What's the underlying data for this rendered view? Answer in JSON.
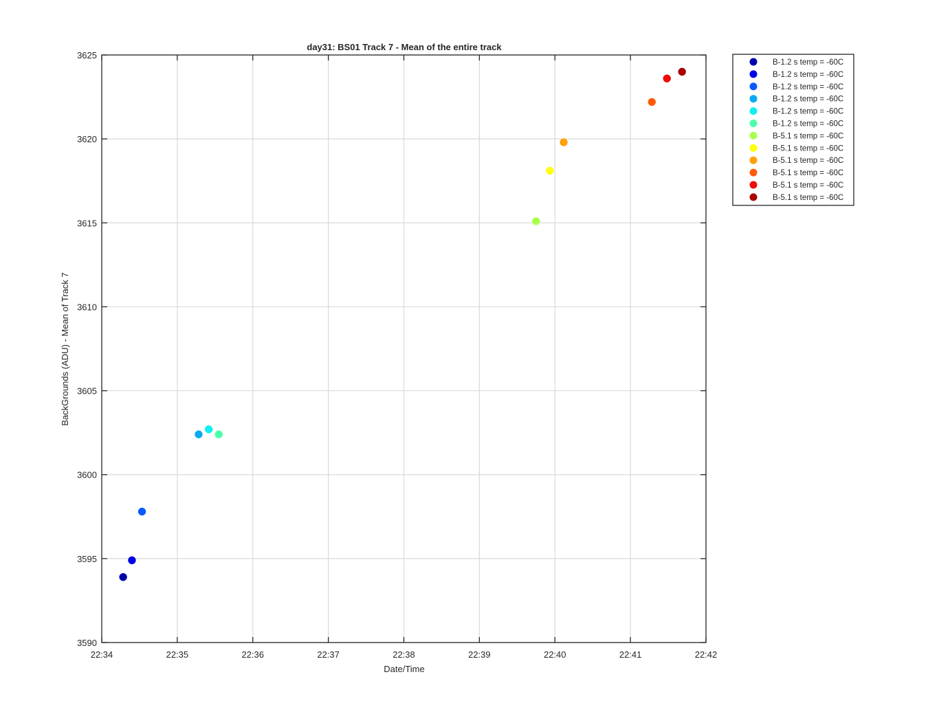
{
  "chart_data": {
    "type": "scatter",
    "title": "day31: BS01  Track 7 - Mean of the entire track",
    "xlabel": "Date/Time",
    "ylabel": "BackGrounds (ADU) - Mean of Track 7",
    "xlim": [
      "22:34",
      "22:42"
    ],
    "ylim": [
      3590,
      3625
    ],
    "x_ticks": [
      "22:34",
      "22:35",
      "22:36",
      "22:37",
      "22:38",
      "22:39",
      "22:40",
      "22:41",
      "22:42"
    ],
    "y_ticks": [
      3590,
      3595,
      3600,
      3605,
      3610,
      3615,
      3620,
      3625
    ],
    "grid": true,
    "legend_position": "outside-top-right",
    "series": [
      {
        "name": "B-1.2 s temp = -60C",
        "color": "#0000aa",
        "points": [
          {
            "x": "22:34:17",
            "y": 3593.9
          }
        ]
      },
      {
        "name": "B-1.2 s temp = -60C",
        "color": "#0000e6",
        "points": [
          {
            "x": "22:34:24",
            "y": 3594.9
          }
        ]
      },
      {
        "name": "B-1.2 s temp = -60C",
        "color": "#0a5aff",
        "points": [
          {
            "x": "22:34:32",
            "y": 3597.8
          }
        ]
      },
      {
        "name": "B-1.2 s temp = -60C",
        "color": "#0aaaf0",
        "points": [
          {
            "x": "22:35:17",
            "y": 3602.4
          }
        ]
      },
      {
        "name": "B-1.2 s temp = -60C",
        "color": "#10f0f0",
        "points": [
          {
            "x": "22:35:25",
            "y": 3602.7
          }
        ]
      },
      {
        "name": "B-1.2 s temp = -60C",
        "color": "#4dffa8",
        "points": [
          {
            "x": "22:35:33",
            "y": 3602.4
          }
        ]
      },
      {
        "name": "B-5.1 s temp = -60C",
        "color": "#a8ff4d",
        "points": [
          {
            "x": "22:39:45",
            "y": 3615.1
          }
        ]
      },
      {
        "name": "B-5.1 s temp = -60C",
        "color": "#ffff10",
        "points": [
          {
            "x": "22:39:56",
            "y": 3618.1
          }
        ]
      },
      {
        "name": "B-5.1 s temp = -60C",
        "color": "#ffa10a",
        "points": [
          {
            "x": "22:40:07",
            "y": 3619.8
          }
        ]
      },
      {
        "name": "B-5.1 s temp = -60C",
        "color": "#ff5a0a",
        "points": [
          {
            "x": "22:41:17",
            "y": 3622.2
          }
        ]
      },
      {
        "name": "B-5.1 s temp = -60C",
        "color": "#f00a0a",
        "points": [
          {
            "x": "22:41:29",
            "y": 3623.6
          }
        ]
      },
      {
        "name": "B-5.1 s temp = -60C",
        "color": "#aa0000",
        "points": [
          {
            "x": "22:41:41",
            "y": 3624.0
          }
        ]
      }
    ]
  }
}
